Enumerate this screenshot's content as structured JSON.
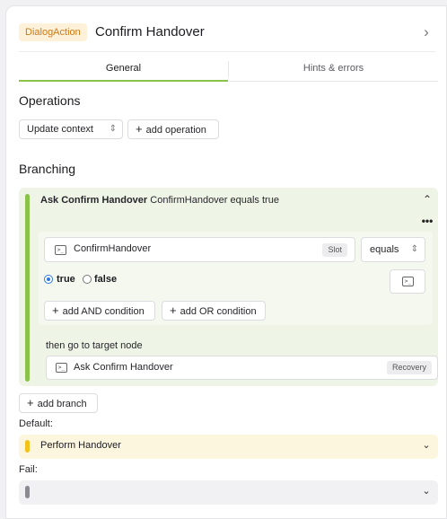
{
  "header": {
    "type_badge": "DialogAction",
    "title": "Confirm Handover",
    "chevron_icon": "chevron-right-icon"
  },
  "tabs": [
    {
      "label": "General",
      "active": true
    },
    {
      "label": "Hints & errors",
      "active": false
    }
  ],
  "operations": {
    "title": "Operations",
    "select_value": "Update context",
    "add_label": "add operation"
  },
  "branching": {
    "title": "Branching",
    "branch": {
      "name": "Ask Confirm Handover",
      "summary": "ConfirmHandover equals true",
      "accent_color": "#8bc34a",
      "condition": {
        "slot_name": "ConfirmHandover",
        "slot_badge": "Slot",
        "operator": "equals",
        "radio_options": [
          {
            "label": "true",
            "checked": true
          },
          {
            "label": "false",
            "checked": false
          }
        ],
        "add_and_label": "add AND condition",
        "add_or_label": "add OR condition"
      },
      "target_label": "then go to target node",
      "target_name": "Ask Confirm Handover",
      "target_badge": "Recovery"
    },
    "add_branch_label": "add branch"
  },
  "default": {
    "label": "Default:",
    "value": "Perform Handover",
    "accent_color": "#f3c21b"
  },
  "fail": {
    "label": "Fail:",
    "value": "",
    "accent_color": "#8a8a90"
  }
}
